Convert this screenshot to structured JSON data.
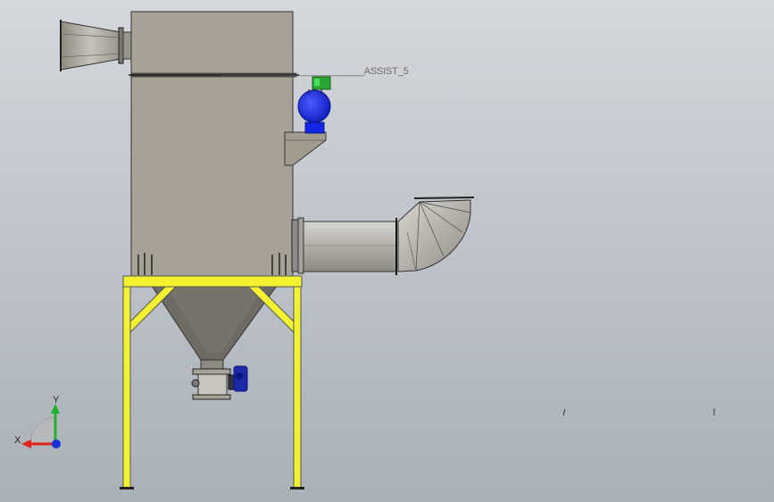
{
  "viewport": {
    "background_top": "#d4d8dd",
    "background_bottom": "#aab0b8"
  },
  "annotation": {
    "label": "___________________________ASSIST_5"
  },
  "triad": {
    "x_label": "X",
    "y_label": "Y",
    "x_color": "#e0201a",
    "y_color": "#22b12a",
    "z_color": "#1530d8"
  },
  "colors": {
    "housing": "#a8a296",
    "frame": "#f2f230",
    "valve": "#1426e8",
    "pipe": "#b4b2ab"
  }
}
